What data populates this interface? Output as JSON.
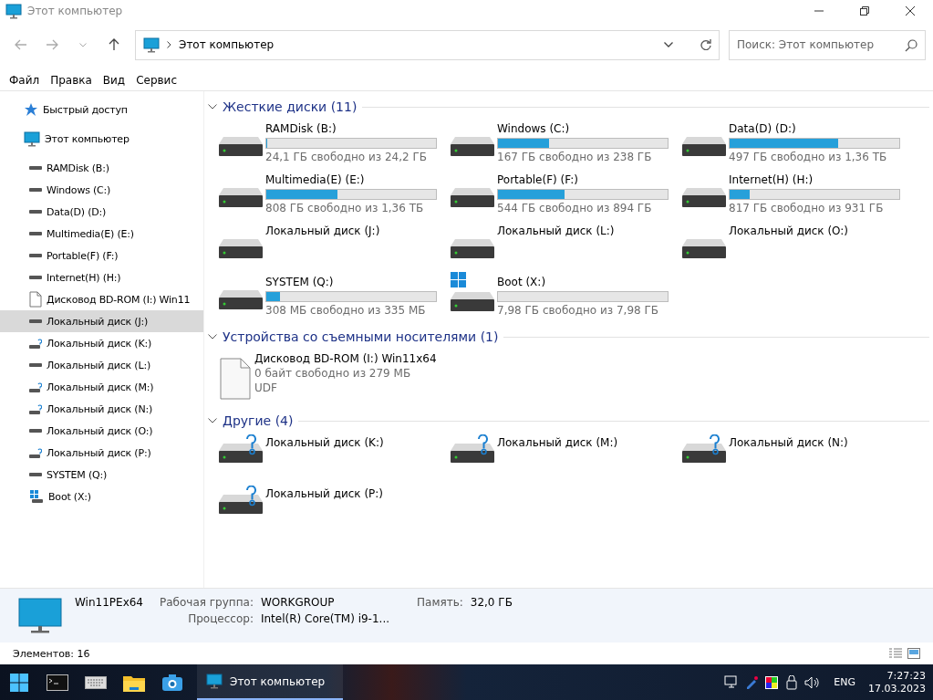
{
  "window": {
    "title": "Этот компьютер"
  },
  "address": {
    "path": "Этот компьютер"
  },
  "search": {
    "placeholder": "Поиск: Этот компьютер"
  },
  "menu": [
    "Файл",
    "Правка",
    "Вид",
    "Сервис"
  ],
  "nav": [
    {
      "label": "Быстрый доступ",
      "kind": "quick",
      "selected": false
    },
    {
      "label": "Этот компьютер",
      "kind": "pc",
      "selected": false,
      "children": [
        {
          "label": "RAMDisk (B:)",
          "kind": "drive",
          "selected": false
        },
        {
          "label": "Windows (C:)",
          "kind": "drive",
          "selected": false
        },
        {
          "label": "Data(D) (D:)",
          "kind": "drive",
          "selected": false
        },
        {
          "label": "Multimedia(E) (E:)",
          "kind": "drive",
          "selected": false
        },
        {
          "label": "Portable(F) (F:)",
          "kind": "drive",
          "selected": false
        },
        {
          "label": "Internet(H) (H:)",
          "kind": "drive",
          "selected": false
        },
        {
          "label": "Дисковод BD-ROM (I:) Win11",
          "kind": "disc",
          "selected": false
        },
        {
          "label": "Локальный диск (J:)",
          "kind": "drive",
          "selected": true
        },
        {
          "label": "Локальный диск (K:)",
          "kind": "unknown",
          "selected": false
        },
        {
          "label": "Локальный диск (L:)",
          "kind": "drive",
          "selected": false
        },
        {
          "label": "Локальный диск (M:)",
          "kind": "unknown",
          "selected": false
        },
        {
          "label": "Локальный диск (N:)",
          "kind": "unknown",
          "selected": false
        },
        {
          "label": "Локальный диск (O:)",
          "kind": "drive",
          "selected": false
        },
        {
          "label": "Локальный диск (P:)",
          "kind": "unknown",
          "selected": false
        },
        {
          "label": "SYSTEM (Q:)",
          "kind": "drive",
          "selected": false
        },
        {
          "label": "Boot (X:)",
          "kind": "boot",
          "selected": false
        }
      ]
    }
  ],
  "groups": [
    {
      "title": "Жесткие диски (11)",
      "expanded": true,
      "items": [
        {
          "name": "RAMDisk (B:)",
          "kind": "drive",
          "level": 0.004,
          "free": "24,1 ГБ свободно из 24,2 ГБ"
        },
        {
          "name": "Windows (C:)",
          "kind": "drive",
          "level": 0.3,
          "free": "167 ГБ свободно из 238 ГБ"
        },
        {
          "name": "Data(D) (D:)",
          "kind": "drive",
          "level": 0.64,
          "free": "497 ГБ свободно из 1,36 ТБ"
        },
        {
          "name": "Multimedia(E) (E:)",
          "kind": "drive",
          "level": 0.42,
          "free": "808 ГБ свободно из 1,36 ТБ"
        },
        {
          "name": "Portable(F) (F:)",
          "kind": "drive",
          "level": 0.39,
          "free": "544 ГБ свободно из 894 ГБ"
        },
        {
          "name": "Internet(H) (H:)",
          "kind": "drive",
          "level": 0.12,
          "free": "817 ГБ свободно из 931 ГБ"
        },
        {
          "name": "Локальный диск (J:)",
          "kind": "drive"
        },
        {
          "name": "Локальный диск (L:)",
          "kind": "drive"
        },
        {
          "name": "Локальный диск (O:)",
          "kind": "drive"
        },
        {
          "name": "SYSTEM (Q:)",
          "kind": "drive",
          "level": 0.08,
          "free": "308 МБ свободно из 335 МБ"
        },
        {
          "name": "Boot (X:)",
          "kind": "boot",
          "level": 0,
          "free": "7,98 ГБ свободно из 7,98 ГБ"
        }
      ]
    },
    {
      "title": "Устройства со съемными носителями (1)",
      "expanded": true,
      "items": [
        {
          "name": "Дисковод BD-ROM (I:) Win11x64",
          "kind": "disc",
          "free": "0 байт свободно из 279 МБ",
          "fs": "UDF"
        }
      ]
    },
    {
      "title": "Другие (4)",
      "expanded": true,
      "items": [
        {
          "name": "Локальный диск (K:)",
          "kind": "unknown"
        },
        {
          "name": "Локальный диск (M:)",
          "kind": "unknown"
        },
        {
          "name": "Локальный диск (N:)",
          "kind": "unknown"
        },
        {
          "name": "Локальный диск (P:)",
          "kind": "unknown"
        }
      ]
    }
  ],
  "details": {
    "name": "Win11PEx64",
    "fields": [
      {
        "label": "Рабочая группа:",
        "value": "WORKGROUP"
      },
      {
        "label": "Память:",
        "value": "32,0 ГБ"
      },
      {
        "label": "Процессор:",
        "value": "Intel(R) Core(TM) i9-1..."
      }
    ]
  },
  "status": "Элементов: 16",
  "taskbar": {
    "window": "Этот компьютер",
    "lang": "ENG",
    "time": "7:27:23",
    "date": "17.03.2023"
  }
}
